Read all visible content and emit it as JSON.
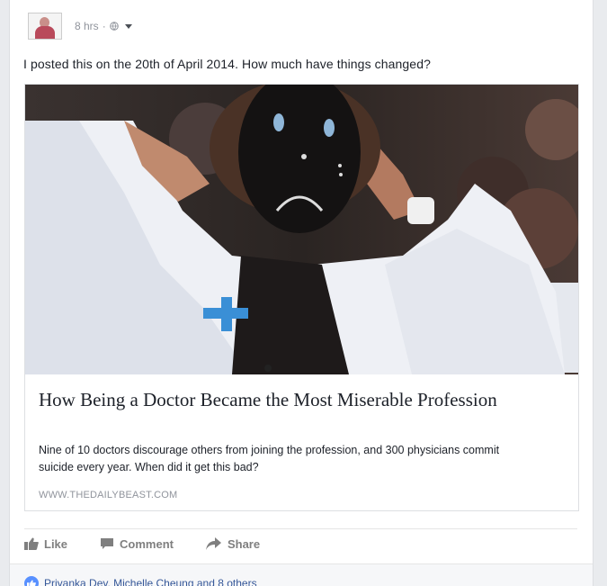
{
  "post": {
    "timestamp": "8 hrs",
    "separator": "·",
    "privacy_icon": "globe-icon",
    "status_text": "I posted this on the 20th of April 2014. How much have things changed?"
  },
  "link_preview": {
    "title": "How Being a Doctor Became the Most Miserable Profession",
    "description": "Nine of 10 doctors discourage others from joining the profession, and 300 physicians commit suicide every year. When did it get this bad?",
    "domain": "WWW.THEDAILYBEAST.COM"
  },
  "actions": {
    "like": "Like",
    "comment": "Comment",
    "share": "Share"
  },
  "reactions": {
    "summary": "Priyanka Dey, Michelle Cheung and 8 others"
  },
  "colors": {
    "link_blue": "#365899",
    "like_blue": "#5890ff",
    "muted_gray": "#90949c"
  }
}
